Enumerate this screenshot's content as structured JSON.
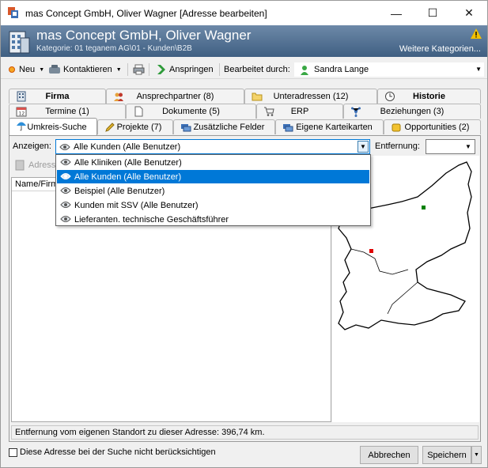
{
  "window": {
    "title": "mas Concept GmbH, Oliver Wagner [Adresse bearbeiten]",
    "min_glyph": "—",
    "max_glyph": "☐",
    "close_glyph": "✕"
  },
  "header": {
    "name": "mas Concept GmbH, Oliver Wagner",
    "category": "Kategorie: 01 teganem AG\\01 - Kunden\\B2B",
    "more_categories": "Weitere Kategorien...",
    "warning_color": "#f3c000"
  },
  "toolbar": {
    "new_label": "Neu",
    "contact_label": "Kontaktieren",
    "jump_label": "Anspringen",
    "edited_by_label": "Bearbeitet durch:",
    "edited_by_value": "Sandra Lange"
  },
  "tabs": {
    "row1": [
      {
        "label": "Firma"
      },
      {
        "label": "Ansprechpartner (8)"
      },
      {
        "label": "Unteradressen (12)"
      },
      {
        "label": "Historie"
      }
    ],
    "row2": [
      {
        "label": "Termine (1)"
      },
      {
        "label": "Dokumente (5)"
      },
      {
        "label": "ERP"
      },
      {
        "label": "Beziehungen (3)"
      }
    ],
    "row3": [
      {
        "label": "Umkreis-Suche"
      },
      {
        "label": "Projekte (7)"
      },
      {
        "label": "Zusätzliche Felder"
      },
      {
        "label": "Eigene Karteikarten"
      },
      {
        "label": "Opportunities (2)"
      }
    ]
  },
  "search": {
    "show_label": "Anzeigen:",
    "selected_filter": "Alle Kunden (Alle Benutzer)",
    "distance_label": "Entfernung:",
    "distance_value": "",
    "address_button": "Adresse",
    "list_header": "Name/Firma",
    "filters": [
      "Alle Kliniken (Alle Benutzer)",
      "Alle Kunden (Alle Benutzer)",
      "Beispiel (Alle Benutzer)",
      "Kunden mit SSV (Alle Benutzer)",
      "Lieferanten. technische Geschäftsführer"
    ],
    "selected_index": 1
  },
  "map": {
    "own_location_color": "#008000",
    "target_location_color": "#e00000"
  },
  "status": {
    "text": "Entfernung vom eigenen Standort zu dieser Adresse: 396,74 km."
  },
  "footer": {
    "ignore_label": "Diese Adresse bei der Suche nicht berücksichtigen",
    "cancel_label": "Abbrechen",
    "save_label": "Speichern"
  }
}
